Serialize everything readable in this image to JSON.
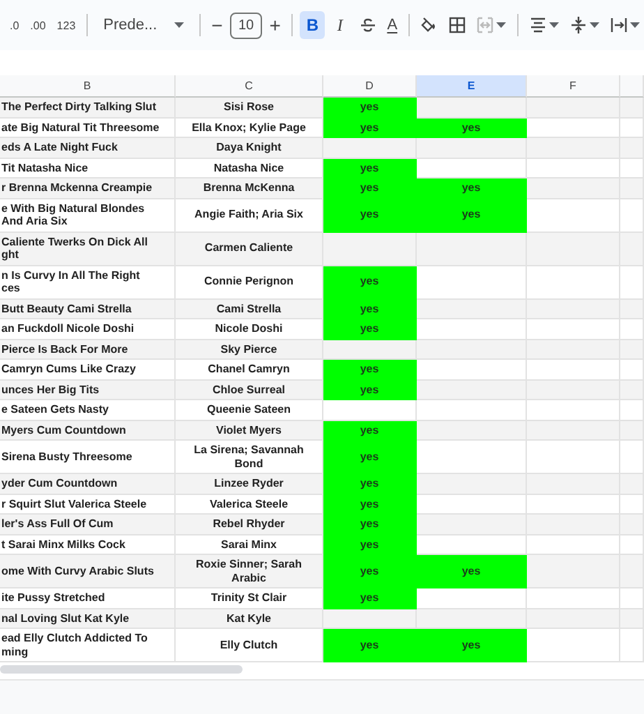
{
  "toolbar": {
    "items": [
      {
        "kind": "decimal-less",
        "label": ".0"
      },
      {
        "kind": "decimal-more",
        "label": ".00"
      },
      {
        "kind": "text",
        "label": "123"
      },
      {
        "kind": "divider"
      },
      {
        "kind": "dropdown",
        "label": "Prede..."
      },
      {
        "kind": "divider"
      },
      {
        "kind": "minus",
        "label": "−"
      },
      {
        "kind": "size",
        "label": "10"
      },
      {
        "kind": "plus",
        "label": "+"
      },
      {
        "kind": "divider"
      },
      {
        "kind": "bold",
        "label": "B",
        "selected": true
      },
      {
        "kind": "italic",
        "label": "I",
        "selected": false
      },
      {
        "kind": "strike"
      },
      {
        "kind": "text-color",
        "label": "A"
      },
      {
        "kind": "divider"
      },
      {
        "kind": "fill"
      },
      {
        "kind": "borders"
      },
      {
        "kind": "merge",
        "disabled": true
      },
      {
        "kind": "divider"
      },
      {
        "kind": "halign"
      },
      {
        "kind": "valign"
      },
      {
        "kind": "wrap"
      }
    ]
  },
  "sheet": {
    "columns": [
      {
        "label": "B",
        "selected": false
      },
      {
        "label": "C",
        "selected": false
      },
      {
        "label": "D",
        "selected": false
      },
      {
        "label": "E",
        "selected": true
      },
      {
        "label": "F",
        "selected": false
      }
    ],
    "rows": [
      {
        "title": "The Perfect Dirty Talking Slut",
        "performers": "Sisi Rose",
        "d": "yes"
      },
      {
        "title": "ate Big Natural Tit Threesome",
        "performers": "Ella Knox; Kylie Page",
        "d": "yes",
        "e": "yes"
      },
      {
        "title": "eds A Late Night Fuck",
        "performers": "Daya Knight"
      },
      {
        "title": "Tit Natasha Nice",
        "performers": "Natasha Nice",
        "d": "yes"
      },
      {
        "title": "r Brenna Mckenna Creampie",
        "performers": "Brenna McKenna",
        "d": "yes",
        "e": "yes"
      },
      {
        "title": "e With Big Natural Blondes\nAnd Aria Six",
        "performers": "Angie Faith; Aria Six",
        "d": "yes",
        "e": "yes"
      },
      {
        "title": "Caliente Twerks On Dick All\nght",
        "performers": "Carmen Caliente"
      },
      {
        "title": "n Is Curvy In All The Right\nces",
        "performers": "Connie Perignon",
        "d": "yes"
      },
      {
        "title": "Butt Beauty Cami Strella",
        "performers": "Cami Strella",
        "d": "yes"
      },
      {
        "title": "an Fuckdoll Nicole Doshi",
        "performers": "Nicole Doshi",
        "d": "yes"
      },
      {
        "title": "Pierce Is Back For More",
        "performers": "Sky Pierce"
      },
      {
        "title": "Camryn Cums Like Crazy",
        "performers": "Chanel Camryn",
        "d": "yes"
      },
      {
        "title": "unces Her Big Tits",
        "performers": "Chloe Surreal",
        "d": "yes"
      },
      {
        "title": "e Sateen Gets Nasty",
        "performers": "Queenie Sateen"
      },
      {
        "title": "Myers Cum Countdown",
        "performers": "Violet Myers",
        "d": "yes"
      },
      {
        "title": "Sirena Busty Threesome",
        "performers": "La Sirena; Savannah\nBond",
        "d": "yes"
      },
      {
        "title": "yder Cum Countdown",
        "performers": "Linzee Ryder",
        "d": "yes"
      },
      {
        "title": "r Squirt Slut Valerica Steele",
        "performers": "Valerica Steele",
        "d": "yes"
      },
      {
        "title": "ler's Ass Full Of Cum",
        "performers": "Rebel Rhyder",
        "d": "yes"
      },
      {
        "title": "t Sarai Minx Milks Cock",
        "performers": "Sarai Minx",
        "d": "yes"
      },
      {
        "title": "ome With Curvy Arabic Sluts",
        "performers": "Roxie Sinner; Sarah\nArabic",
        "d": "yes",
        "e": "yes"
      },
      {
        "title": "ite Pussy Stretched",
        "performers": "Trinity St Clair",
        "d": "yes"
      },
      {
        "title": "nal Loving Slut Kat Kyle",
        "performers": "Kat Kyle"
      },
      {
        "title": "ead Elly Clutch Addicted To\nming",
        "performers": "Elly Clutch",
        "d": "yes",
        "e": "yes"
      }
    ]
  }
}
